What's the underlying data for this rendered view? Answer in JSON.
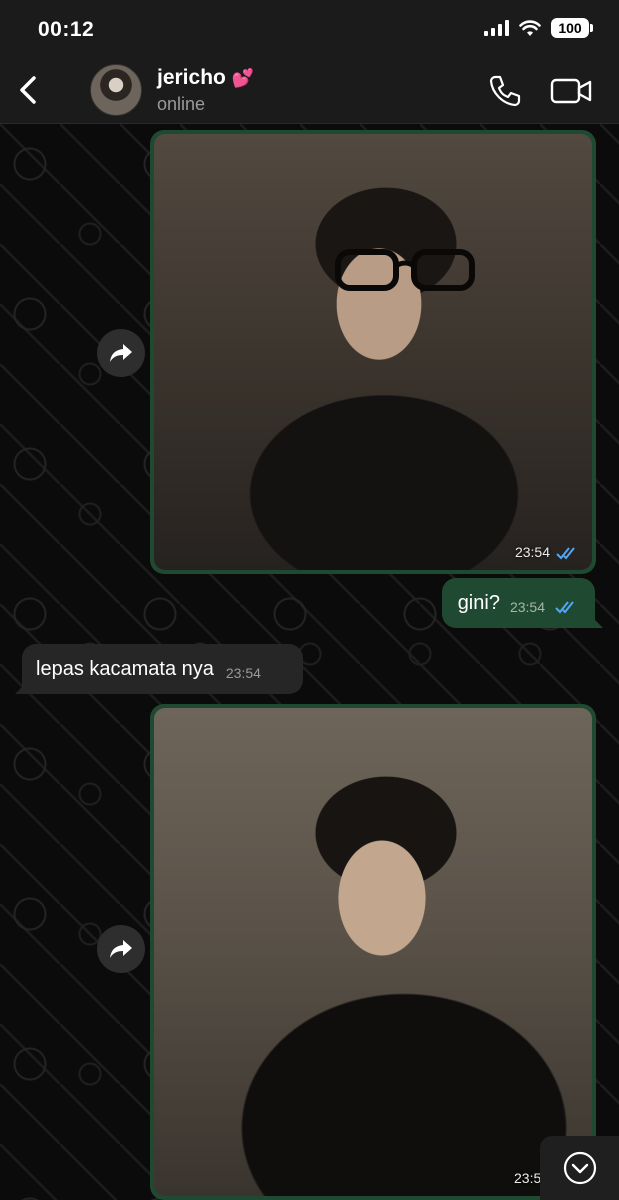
{
  "status_bar": {
    "time": "00:12",
    "battery": "100"
  },
  "header": {
    "contact_name": "jericho",
    "heart": "💕",
    "status": "online"
  },
  "messages": [
    {
      "type": "image",
      "direction": "outgoing",
      "time": "23:54",
      "read": true,
      "forward": true
    },
    {
      "type": "text",
      "direction": "outgoing",
      "text": "gini?",
      "time": "23:54",
      "read": true
    },
    {
      "type": "text",
      "direction": "incoming",
      "text": "lepas kacamata nya",
      "time": "23:54"
    },
    {
      "type": "image",
      "direction": "outgoing",
      "time": "23:5",
      "forward": true
    }
  ],
  "icons": {
    "back": "chevron-left-icon",
    "call": "phone-icon",
    "video": "video-camera-icon",
    "forward": "forward-arrow-icon",
    "scroll": "chevron-down-circle-icon"
  },
  "colors": {
    "outgoing_bubble": "#1f4a31",
    "incoming_bubble": "#262626",
    "read_ticks": "#53a6f5",
    "header_bg": "#1b1b1b"
  }
}
